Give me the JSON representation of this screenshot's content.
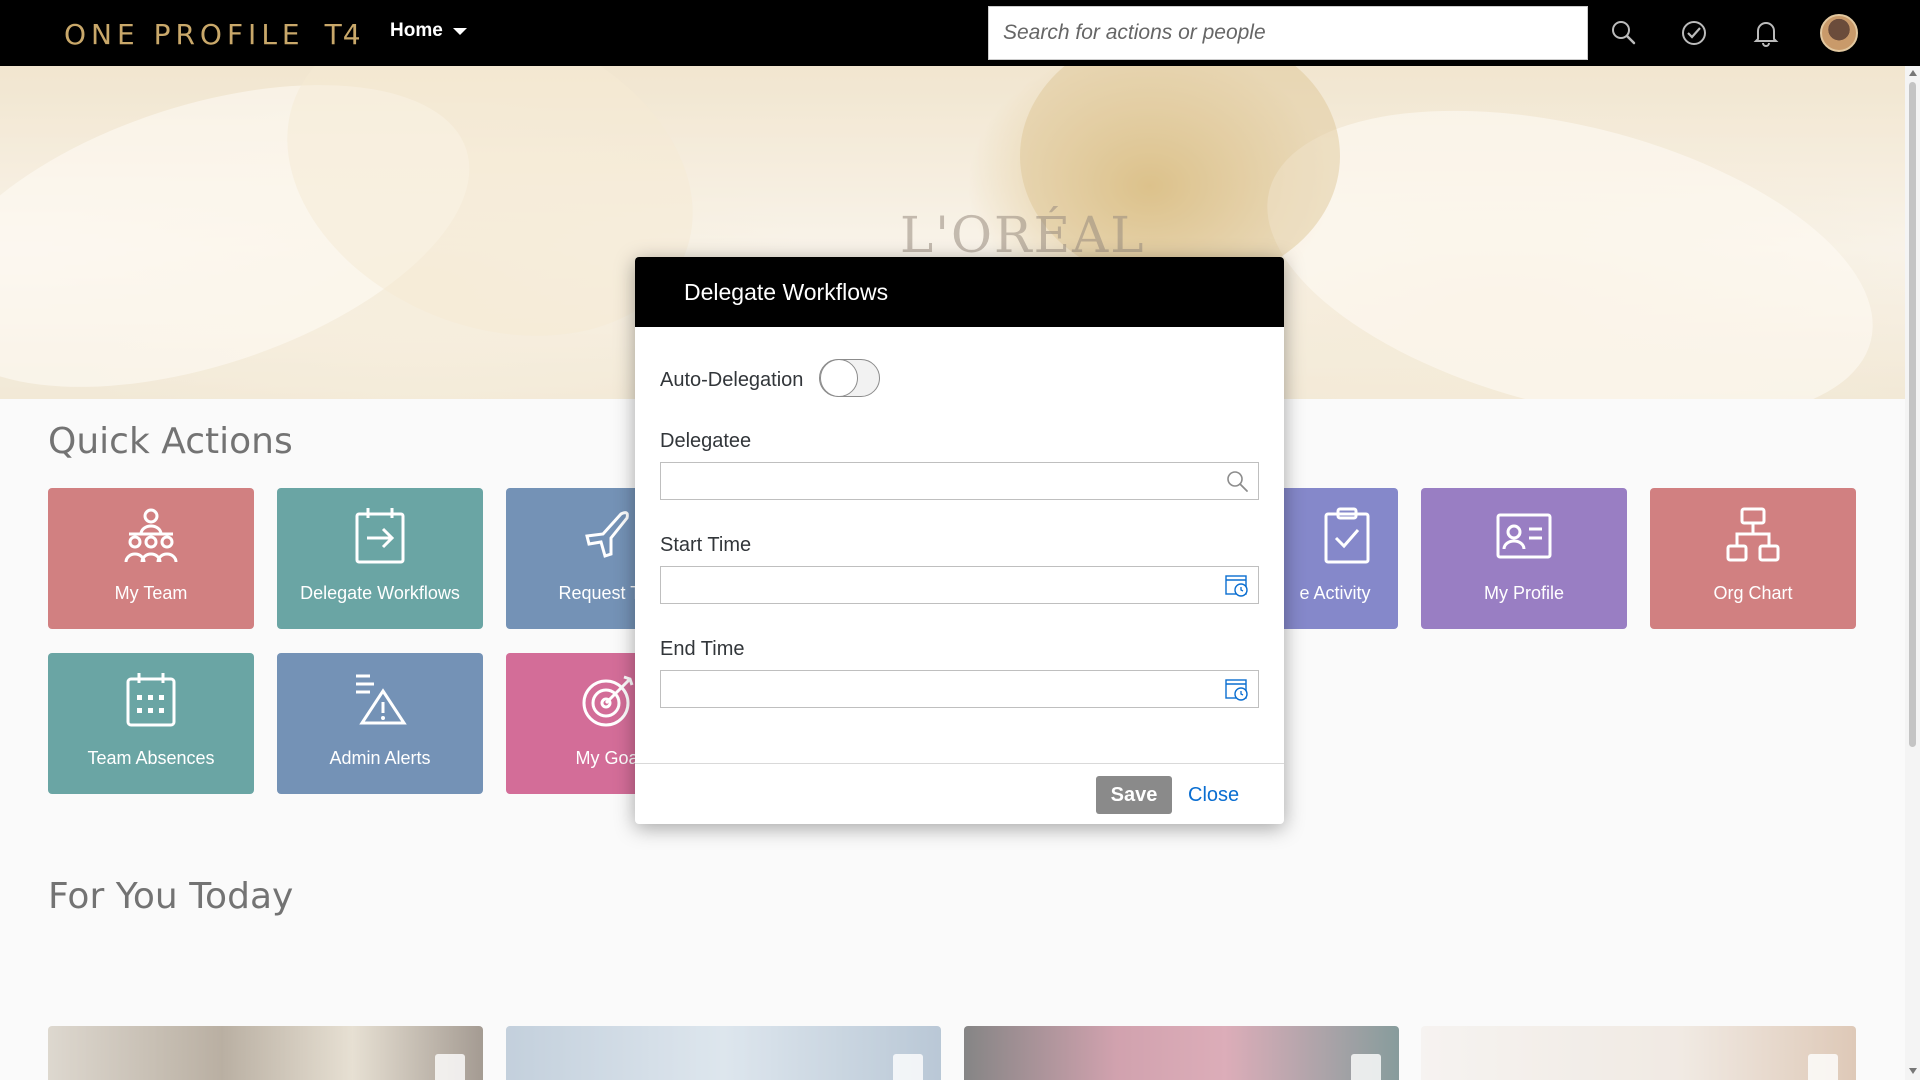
{
  "shell": {
    "logo_text": "ONE PROFILE",
    "logo_suffix": "T4",
    "home_menu_label": "Home",
    "search_placeholder": "Search for actions or people",
    "icons": [
      "search-icon",
      "approvals-check-icon",
      "notifications-bell-icon",
      "user-avatar"
    ]
  },
  "hero": {
    "brand_text": "L'ORÉAL"
  },
  "sections": {
    "quick_actions_title": "Quick Actions",
    "for_you_today_title": "For You Today"
  },
  "tiles": [
    {
      "label": "My Team",
      "color": "#b53235",
      "icon": "team-icon"
    },
    {
      "label": "Delegate Workflows",
      "color": "#0f6f6c",
      "icon": "delegate-icon"
    },
    {
      "label": "Request Tim",
      "color": "#1f4f8a",
      "icon": "airplane-icon"
    },
    {
      "label": "e Activity",
      "color": "#3a3faa",
      "icon": "clipboard-check-icon"
    },
    {
      "label": "My Profile",
      "color": "#5b2f9e",
      "icon": "profile-card-icon"
    },
    {
      "label": "Org Chart",
      "color": "#b53235",
      "icon": "org-chart-icon"
    },
    {
      "label": "Team Absences",
      "color": "#0f6f6c",
      "icon": "calendar-icon"
    },
    {
      "label": "Admin Alerts",
      "color": "#1f4f8a",
      "icon": "alert-icon"
    },
    {
      "label": "My Goal",
      "color": "#b8145a",
      "icon": "target-icon"
    }
  ],
  "dialog": {
    "title": "Delegate Workflows",
    "auto_delegation_label": "Auto-Delegation",
    "auto_delegation_on": false,
    "delegatee_label": "Delegatee",
    "delegatee_value": "",
    "start_time_label": "Start Time",
    "start_time_value": "",
    "end_time_label": "End Time",
    "end_time_value": "",
    "save_label": "Save",
    "close_label": "Close",
    "accent_color": "#0a6ed1"
  }
}
